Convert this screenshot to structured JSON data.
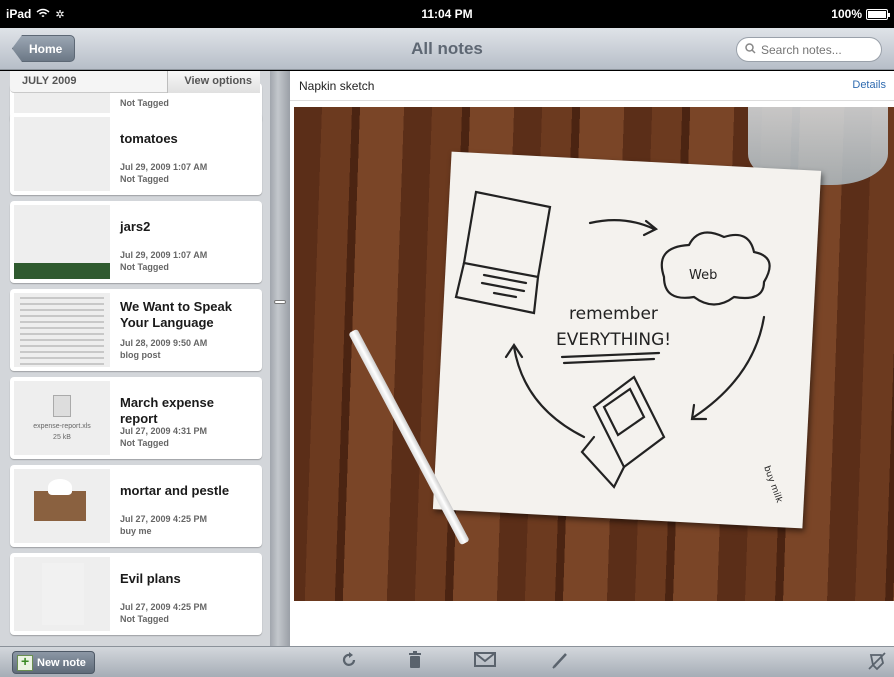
{
  "status": {
    "device": "iPad",
    "time": "11:04 PM",
    "battery": "100%"
  },
  "nav": {
    "home": "Home",
    "title": "All notes",
    "search_placeholder": "Search notes..."
  },
  "sidebar": {
    "month": "JULY 2009",
    "view_options": "View options",
    "partial_tag": "Not Tagged",
    "notes": [
      {
        "title": "tomatoes",
        "date": "Jul 29, 2009 1:07 AM",
        "tag": "Not Tagged"
      },
      {
        "title": "jars2",
        "date": "Jul 29, 2009 1:07 AM",
        "tag": "Not Tagged"
      },
      {
        "title": "We Want to Speak Your Language",
        "date": "Jul 28, 2009 9:50 AM",
        "tag": "blog post"
      },
      {
        "title": "March expense report",
        "date": "Jul 27, 2009 4:31 PM",
        "tag": "Not Tagged",
        "file_name": "expense-report.xls",
        "file_size": "25 kB"
      },
      {
        "title": "mortar and pestle",
        "date": "Jul 27, 2009 4:25 PM",
        "tag": "buy me"
      },
      {
        "title": "Evil plans",
        "date": "Jul 27, 2009 4:25 PM",
        "tag": "Not Tagged"
      }
    ]
  },
  "main": {
    "title": "Napkin sketch",
    "details": "Details",
    "sketch": {
      "line1": "remember",
      "line2": "EVERYTHING!",
      "cloud": "Web",
      "note": "buy milk"
    }
  },
  "toolbar": {
    "new_note": "New note"
  }
}
